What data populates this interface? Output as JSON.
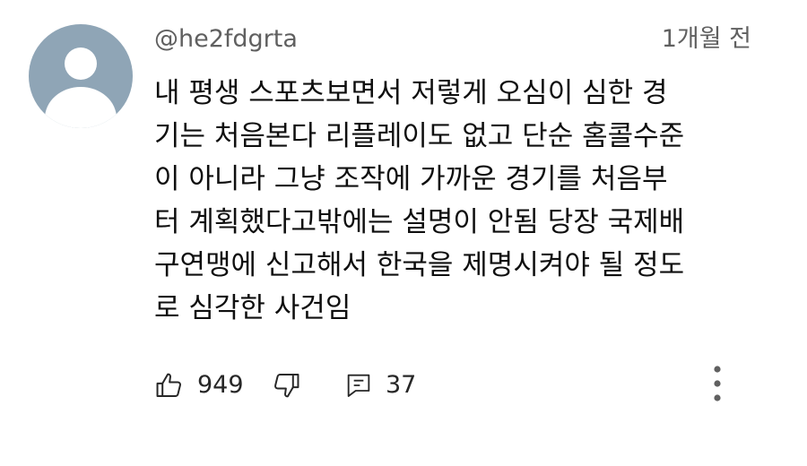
{
  "comment": {
    "author": "@he2fdgrta",
    "time_ago": "1개월 전",
    "text_lines": [
      "내 평생 스포츠보면서 저렇게 오심이 심한 경",
      "기는 처음본다 리플레이도 없고 단순 홈콜수준",
      "이 아니라 그냥 조작에 가까운 경기를 처음부",
      "터 계획했다고밖에는 설명이 안됨 당장 국제배",
      "구연맹에 신고해서 한국을 제명시켜야 될 정도",
      "로 심각한 사건임"
    ],
    "likes": "949",
    "replies": "37"
  },
  "icons": {
    "avatar": "default-avatar-icon",
    "like": "thumbs-up-icon",
    "dislike": "thumbs-down-icon",
    "reply": "comment-icon",
    "menu": "more-vertical-icon"
  },
  "colors": {
    "avatar_bg": "#8fa5b6",
    "secondary_text": "#606060",
    "primary_text": "#0f0f0f"
  }
}
